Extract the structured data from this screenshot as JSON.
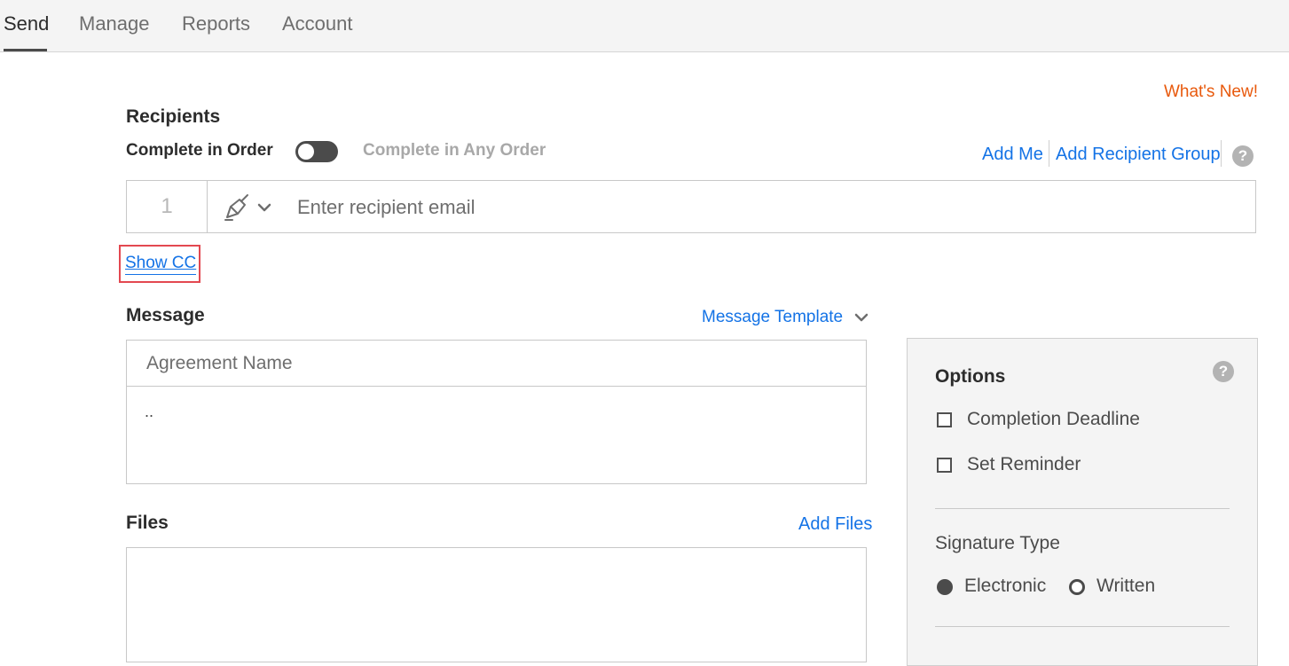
{
  "nav": {
    "tabs": [
      {
        "label": "Send"
      },
      {
        "label": "Manage"
      },
      {
        "label": "Reports"
      },
      {
        "label": "Account"
      }
    ]
  },
  "whats_new": "What's New!",
  "recipients": {
    "title": "Recipients",
    "complete_in_order": "Complete in Order",
    "complete_any_order": "Complete in Any Order",
    "toggle_state": "off",
    "add_me": "Add Me",
    "add_recipient_group": "Add Recipient Group",
    "help_glyph": "?",
    "row_number": "1",
    "role_icon": "pen-sign-icon",
    "email_placeholder": "Enter recipient email",
    "show_cc": "Show CC"
  },
  "message": {
    "title": "Message",
    "template_link": "Message Template",
    "agreement_placeholder": "Agreement Name",
    "body_value": ".."
  },
  "files": {
    "title": "Files",
    "add_files": "Add Files"
  },
  "options": {
    "title": "Options",
    "help_glyph": "?",
    "completion_deadline": "Completion Deadline",
    "set_reminder": "Set Reminder",
    "signature_type_title": "Signature Type",
    "electronic": "Electronic",
    "written": "Written",
    "selected_signature": "Electronic"
  },
  "colors": {
    "link": "#1473e6",
    "whats_new": "#e8590c",
    "highlight_box": "#e34850"
  }
}
